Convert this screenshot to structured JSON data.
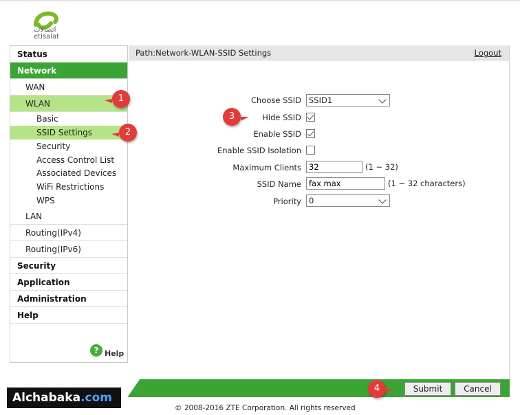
{
  "brand": {
    "arabic": "اتصالات",
    "english": "etisalat",
    "logo_color": "#7ab929"
  },
  "sidebar": {
    "status": "Status",
    "network": "Network",
    "wan": "WAN",
    "wlan": "WLAN",
    "basic": "Basic",
    "ssid_settings": "SSID Settings",
    "security_sub": "Security",
    "acl": "Access Control List",
    "associated": "Associated Devices",
    "wifi_restrictions": "WiFi Restrictions",
    "wps": "WPS",
    "lan": "LAN",
    "routing_v4": "Routing(IPv4)",
    "routing_v6": "Routing(IPv6)",
    "security": "Security",
    "application": "Application",
    "administration": "Administration",
    "help": "Help",
    "help_bottom": "Help",
    "help_icon_glyph": "?"
  },
  "header": {
    "path": "Path:Network-WLAN-SSID Settings",
    "logout": "Logout"
  },
  "form": {
    "choose_ssid_label": "Choose SSID",
    "choose_ssid_value": "SSID1",
    "hide_ssid_label": "Hide SSID",
    "hide_ssid_checked": true,
    "enable_ssid_label": "Enable SSID",
    "enable_ssid_checked": true,
    "isolation_label": "Enable SSID Isolation",
    "isolation_checked": false,
    "max_clients_label": "Maximum Clients",
    "max_clients_value": "32",
    "max_clients_hint": "(1 ~ 32)",
    "ssid_name_label": "SSID Name",
    "ssid_name_value": "fax max",
    "ssid_name_hint": "(1 ~ 32 characters)",
    "priority_label": "Priority",
    "priority_value": "0"
  },
  "buttons": {
    "submit": "Submit",
    "cancel": "Cancel"
  },
  "footer": {
    "copyright": "© 2008-2016 ZTE Corporation. All rights reserved"
  },
  "markers": {
    "m1": "1",
    "m2": "2",
    "m3": "3",
    "m4": "4"
  },
  "watermark": {
    "name": "Alchabaka",
    "tld": ".com"
  },
  "colors": {
    "accent_green": "#3aa535",
    "light_green": "#b4e486",
    "marker_red": "#e23b3b"
  }
}
